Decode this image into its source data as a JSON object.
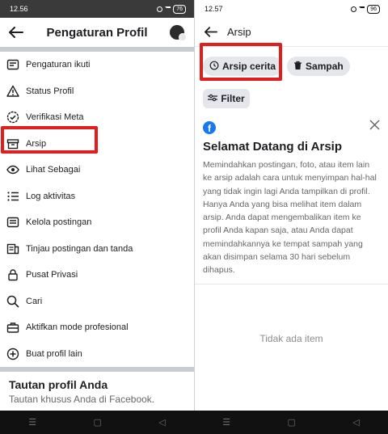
{
  "left": {
    "status": {
      "time": "12.56",
      "battery": "76"
    },
    "title": "Pengaturan Profil",
    "menu": [
      {
        "label": "Pengaturan ikuti",
        "icon": "gear-icon"
      },
      {
        "label": "Status Profil",
        "icon": "warning-icon"
      },
      {
        "label": "Verifikasi Meta",
        "icon": "verified-badge-icon"
      },
      {
        "label": "Arsip",
        "icon": "archive-box-icon"
      },
      {
        "label": "Lihat Sebagai",
        "icon": "eye-icon"
      },
      {
        "label": "Log aktivitas",
        "icon": "list-icon"
      },
      {
        "label": "Kelola postingan",
        "icon": "post-manage-icon"
      },
      {
        "label": "Tinjau postingan dan tanda",
        "icon": "tag-review-icon"
      },
      {
        "label": "Pusat Privasi",
        "icon": "lock-icon"
      },
      {
        "label": "Cari",
        "icon": "search-icon"
      },
      {
        "label": "Aktifkan mode profesional",
        "icon": "briefcase-icon"
      },
      {
        "label": "Buat profil lain",
        "icon": "plus-circle-icon"
      }
    ],
    "profile_link": {
      "heading": "Tautan profil Anda",
      "subtitle": "Tautan khusus Anda di Facebook."
    }
  },
  "right": {
    "status": {
      "time": "12.57",
      "battery": "96"
    },
    "title": "Arsip",
    "chips": [
      {
        "label": "Arsip cerita",
        "icon": "clock-history-icon"
      },
      {
        "label": "Sampah",
        "icon": "trash-icon"
      }
    ],
    "filter_label": "Filter",
    "welcome": {
      "heading": "Selamat Datang di Arsip",
      "body": "Memindahkan postingan, foto, atau item lain ke arsip adalah cara untuk menyimpan hal-hal yang tidak ingin lagi Anda tampilkan di profil. Hanya Anda yang bisa melihat item dalam arsip. Anda dapat mengembalikan item ke profil Anda kapan saja, atau Anda dapat memindahkannya ke tempat sampah yang akan disimpan selama 30 hari sebelum dihapus."
    },
    "empty_state": "Tidak ada item"
  },
  "colors": {
    "highlight": "#e11d1d",
    "facebook_blue": "#1877f2",
    "chip_bg": "#e4e6eb"
  },
  "nav_glyphs": {
    "recents": "☰",
    "home": "▢",
    "back": "◁"
  }
}
